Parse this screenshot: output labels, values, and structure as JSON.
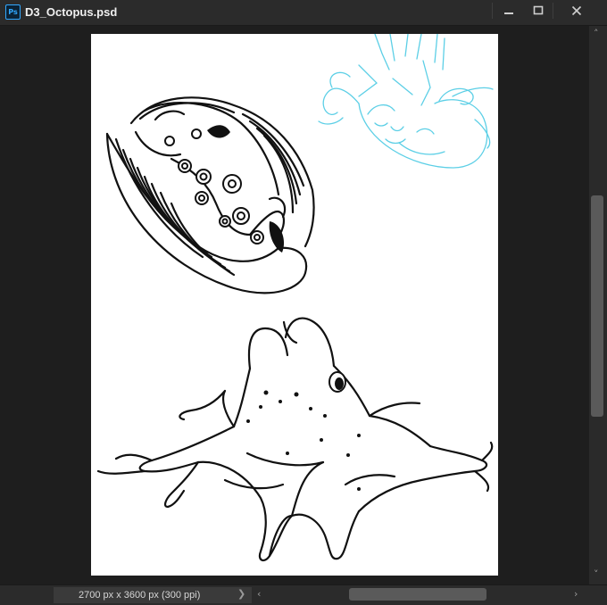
{
  "window": {
    "app_icon": "ps-icon",
    "app_icon_text": "Ps",
    "title": "D3_Octopus.psd",
    "controls": [
      "minimize-icon",
      "maximize-icon",
      "close-icon"
    ]
  },
  "canvas": {
    "background": "#ffffff",
    "sketch_color": "#5ccfe6",
    "ink_color": "#111111"
  },
  "status": {
    "doc_info": "2700 px x 3600 px (300 ppi)",
    "expand_arrow": "❯",
    "scroll_left": "‹",
    "scroll_right": "›",
    "scroll_up": "˄",
    "scroll_down": "˅"
  }
}
